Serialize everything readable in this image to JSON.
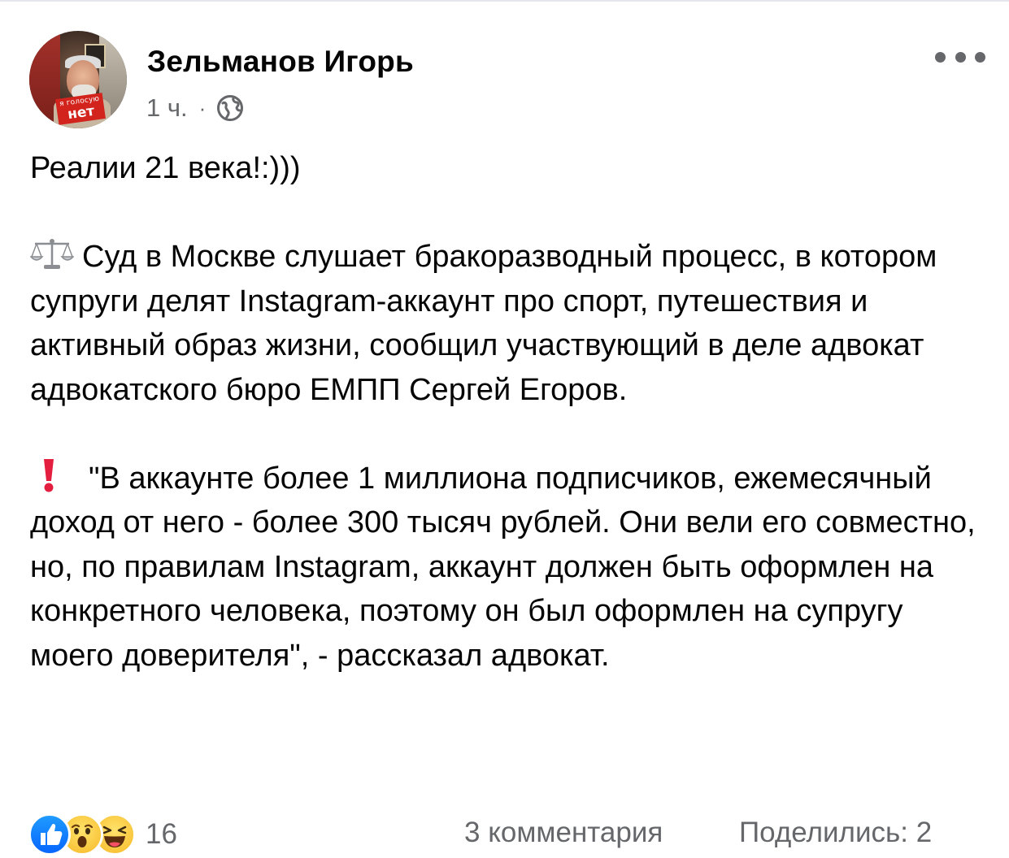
{
  "post": {
    "author": {
      "name": "Зельманов Игорь",
      "avatar_badge_line1": "я голосую",
      "avatar_badge_line2": "нет"
    },
    "time": "1 ч.",
    "separator": "·",
    "privacy_icon": "globe-icon",
    "more_icon": "more-options-icon",
    "paragraphs": [
      "Реалии 21 века!:)))",
      "Суд в Москве слушает бракоразводный процесс, в котором супруги делят Instagram-аккаунт про спорт, путешествия и активный образ жизни, сообщил участвующий в деле адвокат адвокатского бюро ЕМПП Сергей Егоров.",
      "\"В аккаунте более 1 миллиона подписчиков, ежемесячный доход от него - более 300 тысяч рублей. Они вели его совместно, но, по правилам Instagram, аккаунт должен быть оформлен на конкретного человека, поэтому он был оформлен на супругу моего доверителя\", - рассказал адвокат."
    ],
    "paragraph_icons": [
      "",
      "balance-scale-icon",
      "red-exclamation-icon"
    ]
  },
  "footer": {
    "reaction_icons": [
      "like-icon",
      "wow-icon",
      "haha-icon"
    ],
    "reaction_count": "16",
    "comments": "3 комментария",
    "shares": "Поделились: 2"
  },
  "colors": {
    "text_primary": "#050505",
    "text_secondary": "#65676b",
    "like_blue": "#0866ff",
    "reaction_yellow": "#f7b928",
    "exclamation_red": "#e41e3f"
  }
}
